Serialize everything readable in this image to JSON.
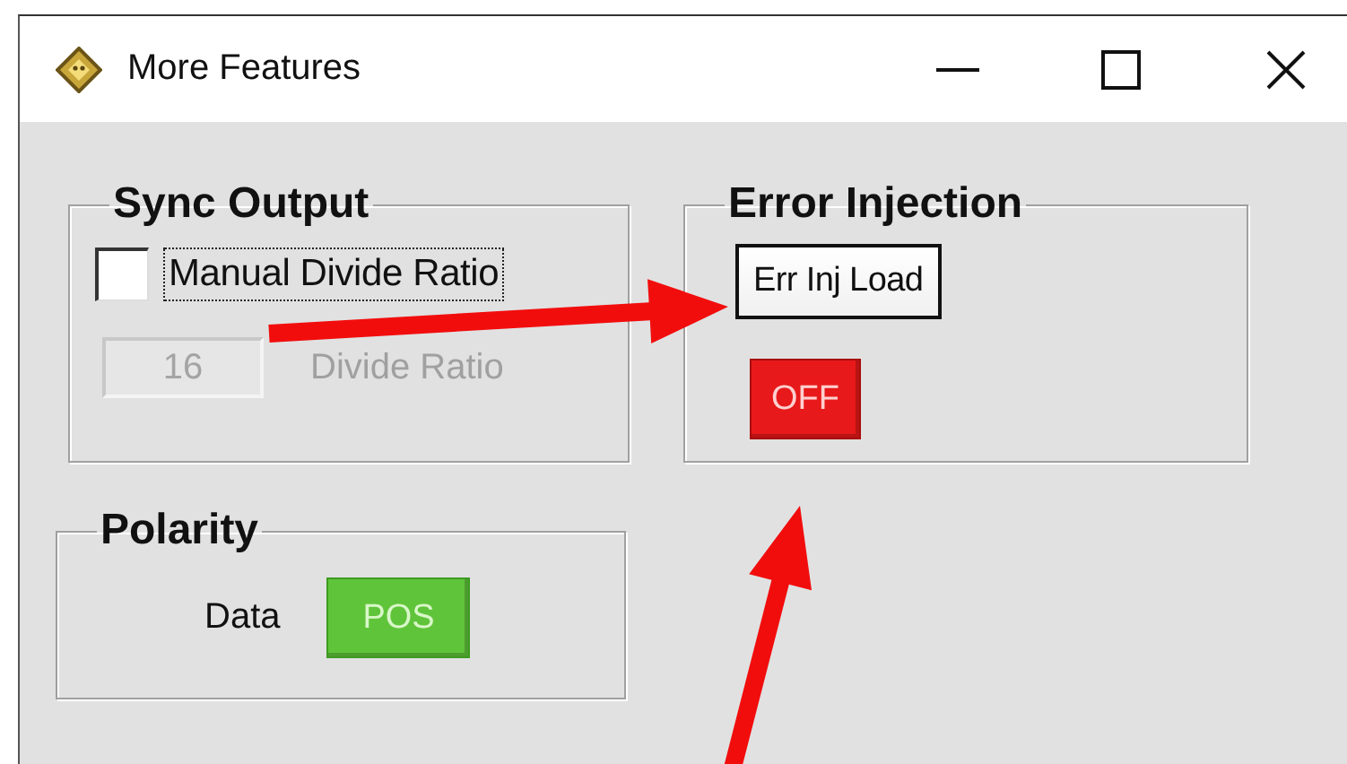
{
  "window": {
    "title": "More Features"
  },
  "sync_output": {
    "title": "Sync Output",
    "manual_divide_ratio": {
      "label": "Manual Divide Ratio",
      "checked": false,
      "focused": true
    },
    "divide_ratio": {
      "value": "16",
      "label": "Divide Ratio",
      "disabled": true
    }
  },
  "error_injection": {
    "title": "Error Injection",
    "load_button": "Err Inj Load",
    "toggle": {
      "label": "OFF",
      "on": false
    }
  },
  "polarity": {
    "title": "Polarity",
    "label": "Data",
    "toggle": {
      "label": "POS",
      "on": true
    }
  },
  "annotations": [
    {
      "kind": "arrow"
    },
    {
      "kind": "arrow"
    }
  ]
}
